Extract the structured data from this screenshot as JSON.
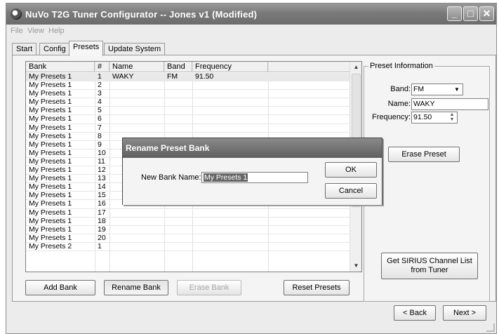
{
  "window": {
    "title": "NuVo T2G Tuner Configurator -- Jones v1 (Modified)",
    "minimize": "_",
    "maximize": "□",
    "close": "✕"
  },
  "menu": [
    "File",
    "View",
    "Help"
  ],
  "tabs": [
    "Start",
    "Config",
    "Presets",
    "Update System"
  ],
  "active_tab": "Presets",
  "presets_table": {
    "columns": [
      "Bank",
      "#",
      "Name",
      "Band",
      "Frequency"
    ],
    "rows": [
      [
        "My Presets 1",
        "1",
        "WAKY",
        "FM",
        "91.50"
      ],
      [
        "My Presets 1",
        "2",
        "",
        "",
        ""
      ],
      [
        "My Presets 1",
        "3",
        "",
        "",
        ""
      ],
      [
        "My Presets 1",
        "4",
        "",
        "",
        ""
      ],
      [
        "My Presets 1",
        "5",
        "",
        "",
        ""
      ],
      [
        "My Presets 1",
        "6",
        "",
        "",
        ""
      ],
      [
        "My Presets 1",
        "7",
        "",
        "",
        ""
      ],
      [
        "My Presets 1",
        "8",
        "",
        "",
        ""
      ],
      [
        "My Presets 1",
        "9",
        "",
        "",
        ""
      ],
      [
        "My Presets 1",
        "10",
        "",
        "",
        ""
      ],
      [
        "My Presets 1",
        "11",
        "",
        "",
        ""
      ],
      [
        "My Presets 1",
        "12",
        "",
        "",
        ""
      ],
      [
        "My Presets 1",
        "13",
        "",
        "",
        ""
      ],
      [
        "My Presets 1",
        "14",
        "",
        "",
        ""
      ],
      [
        "My Presets 1",
        "15",
        "",
        "",
        ""
      ],
      [
        "My Presets 1",
        "16",
        "",
        "",
        ""
      ],
      [
        "My Presets 1",
        "17",
        "",
        "",
        ""
      ],
      [
        "My Presets 1",
        "18",
        "",
        "",
        ""
      ],
      [
        "My Presets 1",
        "19",
        "",
        "",
        ""
      ],
      [
        "My Presets 1",
        "20",
        "",
        "",
        ""
      ],
      [
        "My Presets 2",
        "1",
        "",
        "",
        ""
      ]
    ]
  },
  "table_buttons": {
    "add_bank": "Add Bank",
    "rename_bank": "Rename Bank",
    "erase_bank": "Erase Bank",
    "reset_presets": "Reset Presets"
  },
  "preset_info": {
    "legend": "Preset Information",
    "band_label": "Band:",
    "band_value": "FM",
    "name_label": "Name:",
    "name_value": "WAKY",
    "frequency_label": "Frequency:",
    "frequency_value": "91.50",
    "erase_preset": "Erase Preset",
    "get_sirius_line1": "Get SIRIUS Channel List",
    "get_sirius_line2": "from Tuner"
  },
  "dialog": {
    "title": "Rename Preset Bank",
    "field_label": "New Bank Name:",
    "field_value": "My Presets 1",
    "ok": "OK",
    "cancel": "Cancel"
  },
  "nav": {
    "back": "< Back",
    "next": "Next >"
  },
  "colors": {
    "titlebar": "#7a7a7a",
    "window_bg": "#ececec",
    "selection": "#666666"
  }
}
